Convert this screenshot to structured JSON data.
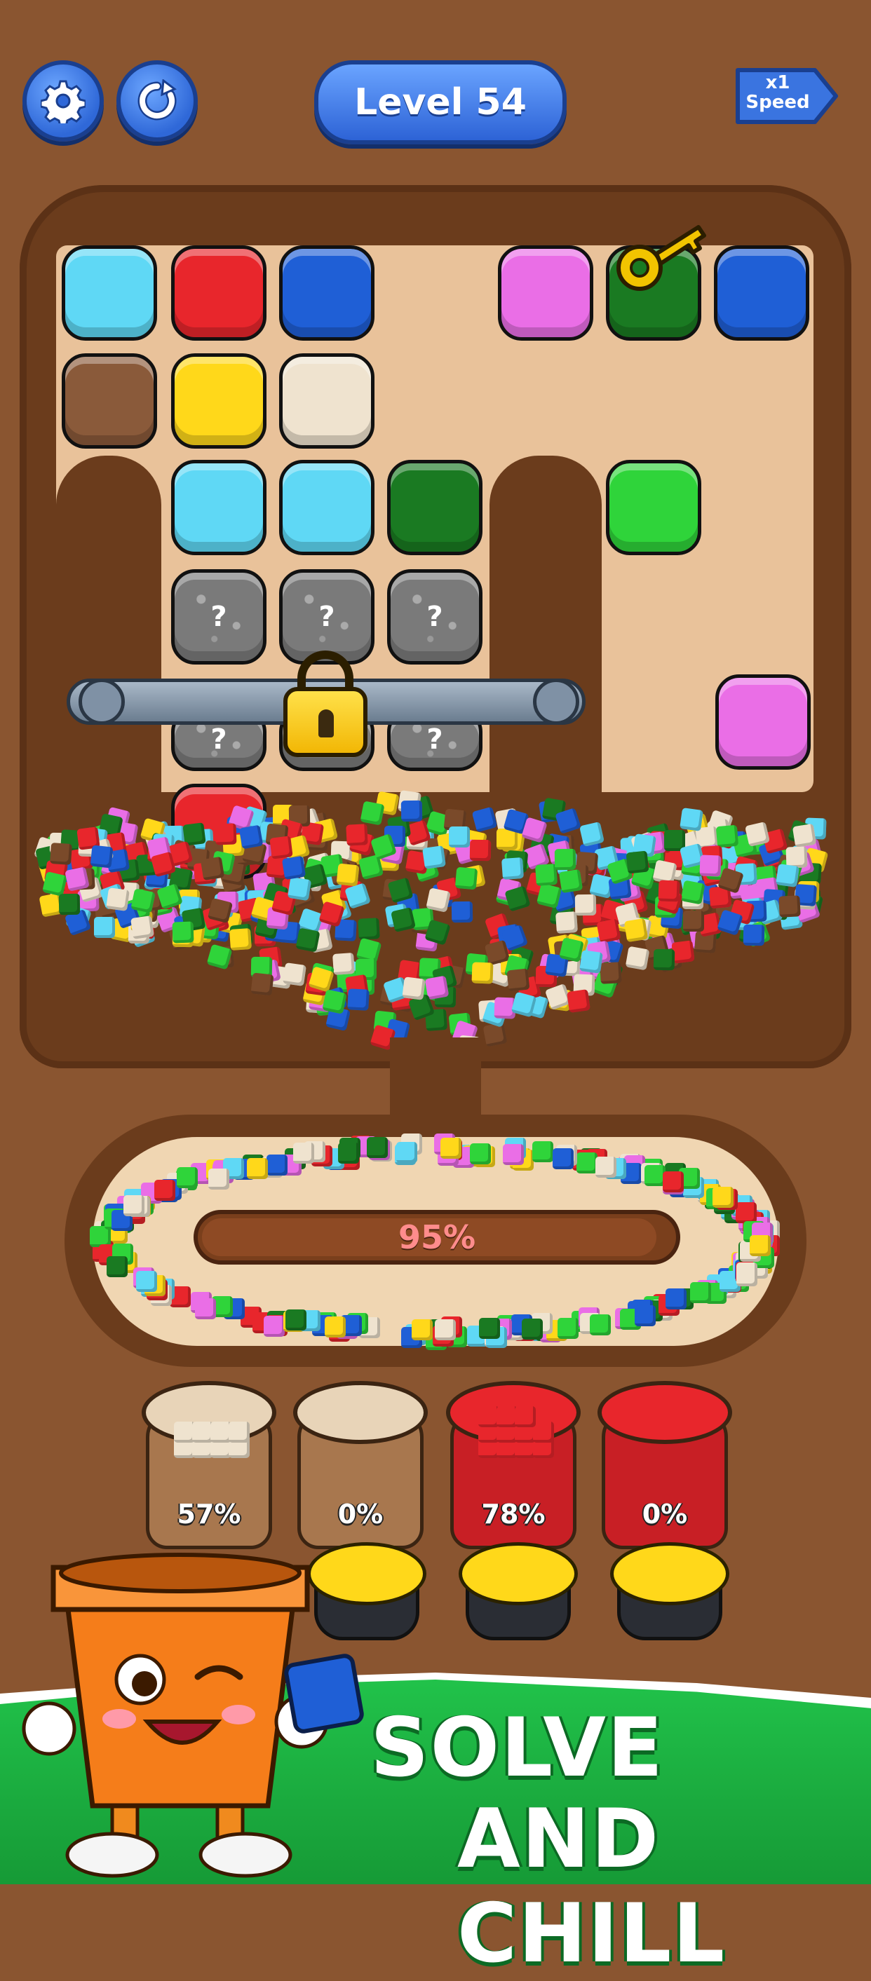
{
  "header": {
    "settings_icon": "gear-icon",
    "restart_icon": "restart-icon",
    "level_label": "Level 54",
    "speed_multiplier": "x1",
    "speed_label": "Speed"
  },
  "board": {
    "blocks": [
      {
        "color": "#5fd8f5",
        "type": "color"
      },
      {
        "color": "#e8262c",
        "type": "color"
      },
      {
        "color": "#1f5fd6",
        "type": "color"
      },
      {
        "color": "#ea6ee6",
        "type": "color"
      },
      {
        "color": "#1a7a22",
        "type": "key"
      },
      {
        "color": "#1f5fd6",
        "type": "color"
      },
      {
        "color": "#8a5a3a",
        "type": "color"
      },
      {
        "color": "#ffd81a",
        "type": "color"
      },
      {
        "color": "#efe3cf",
        "type": "color"
      },
      {
        "color": "#5fd8f5",
        "type": "color"
      },
      {
        "color": "#5fd8f5",
        "type": "color"
      },
      {
        "color": "#1a7a22",
        "type": "color"
      },
      {
        "color": "#2fd43a",
        "type": "color"
      },
      {
        "color": "#7a7a7a",
        "type": "mystery"
      },
      {
        "color": "#7a7a7a",
        "type": "mystery"
      },
      {
        "color": "#7a7a7a",
        "type": "mystery"
      },
      {
        "color": "#ea6ee6",
        "type": "color"
      },
      {
        "color": "#e8262c",
        "type": "color"
      }
    ],
    "lock_icon": "padlock-icon",
    "key_icon": "key-icon",
    "mystery_glyph": "?"
  },
  "conveyor": {
    "progress_percent": 95,
    "progress_label": "95%"
  },
  "jars": [
    {
      "color": "#efe3cf",
      "percent": 57,
      "label": "57%"
    },
    {
      "color": "#efe3cf",
      "percent": 0,
      "label": "0%"
    },
    {
      "color": "#e8262c",
      "percent": 78,
      "label": "78%"
    },
    {
      "color": "#e8262c",
      "percent": 0,
      "label": "0%"
    }
  ],
  "cups": [
    {
      "color": "#ffd81a"
    },
    {
      "color": "#ffd81a"
    },
    {
      "color": "#ffd81a"
    }
  ],
  "banner": {
    "line1": "SOLVE",
    "line2": "AND CHILL",
    "mascot": "flower-pot-mascot"
  },
  "palette": [
    "#e8262c",
    "#1f5fd6",
    "#5fd8f5",
    "#ffd81a",
    "#2fd43a",
    "#1a7a22",
    "#ea6ee6",
    "#efe3cf",
    "#7a4a2a"
  ]
}
